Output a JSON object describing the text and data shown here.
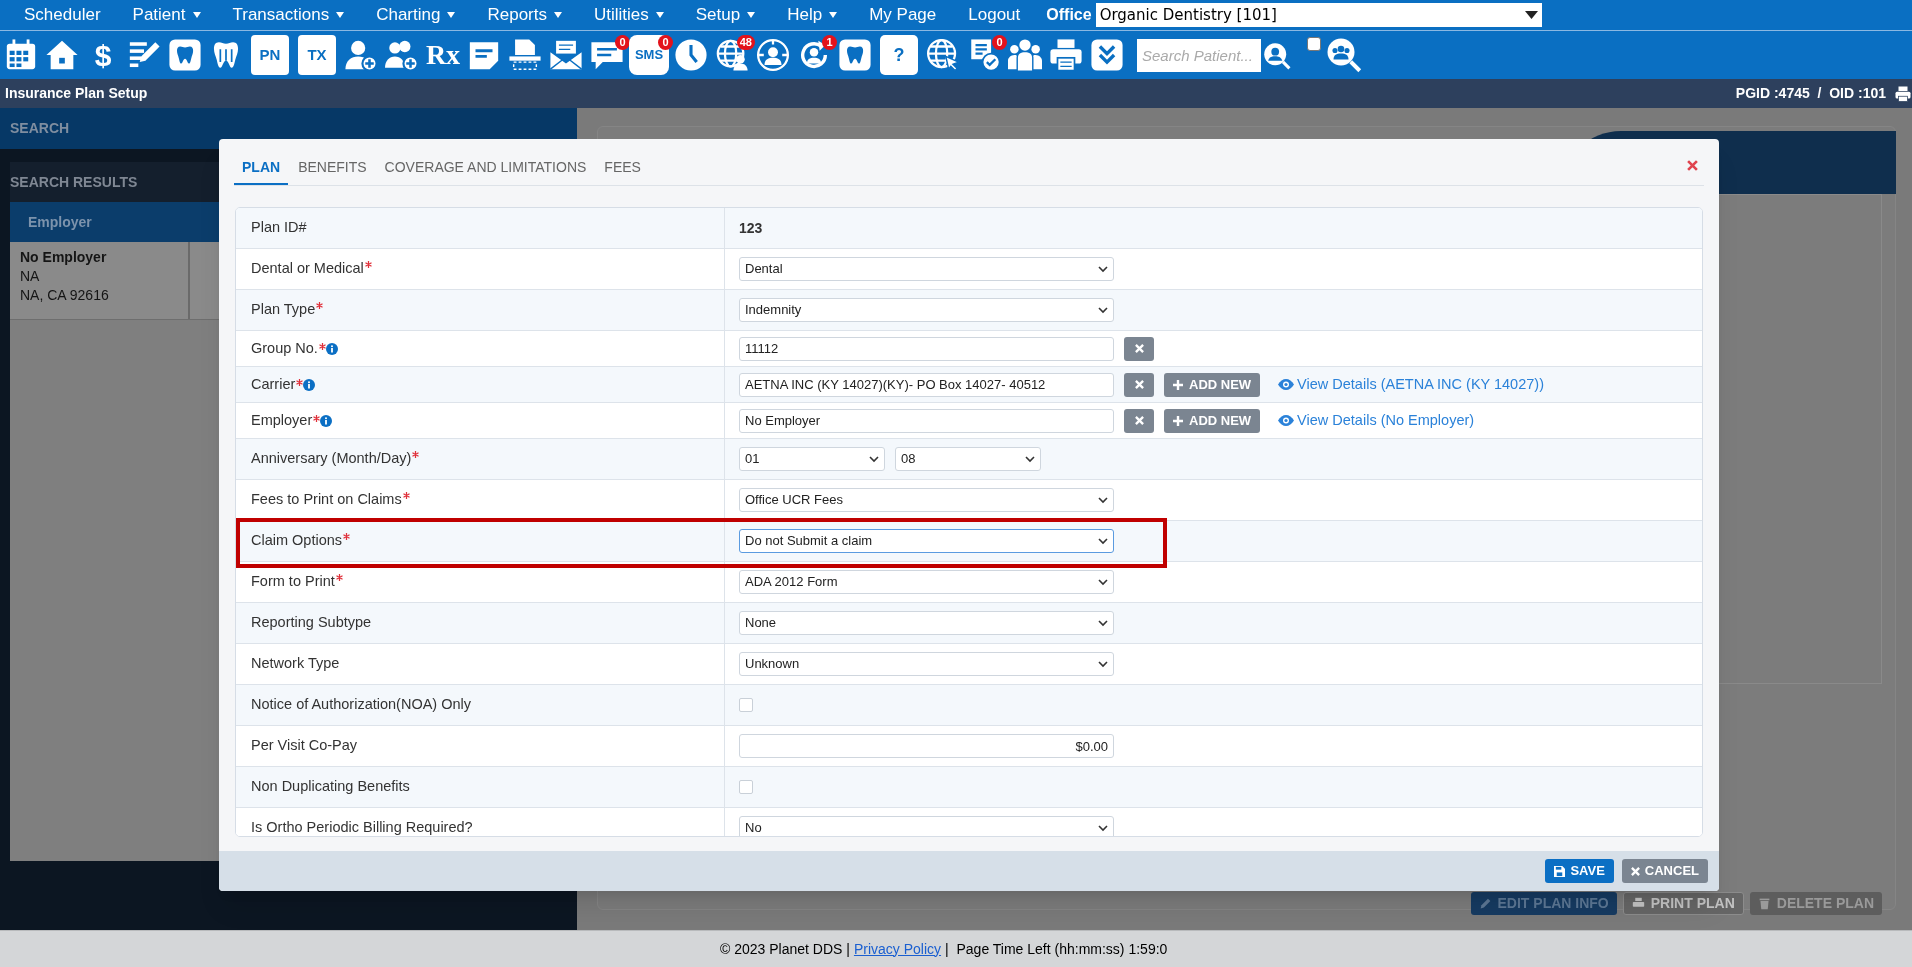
{
  "menu": [
    {
      "label": "Scheduler",
      "dropdown": false
    },
    {
      "label": "Patient",
      "dropdown": true
    },
    {
      "label": "Transactions",
      "dropdown": true
    },
    {
      "label": "Charting",
      "dropdown": true
    },
    {
      "label": "Reports",
      "dropdown": true
    },
    {
      "label": "Utilities",
      "dropdown": true
    },
    {
      "label": "Setup",
      "dropdown": true
    },
    {
      "label": "Help",
      "dropdown": true
    },
    {
      "label": "My Page",
      "dropdown": false
    },
    {
      "label": "Logout",
      "dropdown": false
    }
  ],
  "office": {
    "label": "Office",
    "value": "Organic Dentistry [101]"
  },
  "toolbar": {
    "items": [
      {
        "kind": "calendar"
      },
      {
        "kind": "home"
      },
      {
        "kind": "text",
        "text": "$"
      },
      {
        "kind": "notes"
      },
      {
        "kind": "tooth_card"
      },
      {
        "kind": "tooth"
      },
      {
        "kind": "text",
        "text": "PN"
      },
      {
        "kind": "text",
        "text": "TX"
      },
      {
        "kind": "user_add"
      },
      {
        "kind": "users_add"
      },
      {
        "kind": "rx",
        "text": "Rx"
      },
      {
        "kind": "note"
      },
      {
        "kind": "scanner"
      },
      {
        "kind": "mail"
      },
      {
        "kind": "chat",
        "badge": "0"
      },
      {
        "kind": "bubble",
        "text": "SMS",
        "badge": "0"
      },
      {
        "kind": "clock"
      },
      {
        "kind": "globe_user",
        "badge": "48"
      },
      {
        "kind": "globe_person"
      },
      {
        "kind": "refresh_user",
        "badge": "1"
      },
      {
        "kind": "tooth_card"
      },
      {
        "kind": "tooth_text",
        "text": "?"
      },
      {
        "kind": "globe_cursor"
      },
      {
        "kind": "checklist",
        "badge": "0"
      },
      {
        "kind": "people"
      },
      {
        "kind": "printer"
      },
      {
        "kind": "chevrons"
      }
    ],
    "search": {
      "placeholder": "Search Patient..."
    },
    "checkbox": {
      "checked": false
    }
  },
  "title_bar": {
    "title": "Insurance Plan Setup",
    "ids": "PGID :4745  /  OID :101"
  },
  "search_panel": {
    "header": "SEARCH",
    "results_title": "SEARCH RESULTS",
    "columns": [
      "Employer"
    ],
    "rows": [
      {
        "name": "No Employer",
        "line_2": "NA",
        "line_3": "NA, CA 92616"
      }
    ]
  },
  "background_buttons": [
    {
      "kind": "edit",
      "label": "EDIT PLAN INFO"
    },
    {
      "kind": "print",
      "label": "PRINT PLAN"
    },
    {
      "kind": "delete",
      "label": "DELETE PLAN"
    }
  ],
  "modal": {
    "tabs": [
      {
        "label": "PLAN",
        "selected": true
      },
      {
        "label": "BENEFITS",
        "selected": false
      },
      {
        "label": "COVERAGE AND LIMITATIONS",
        "selected": false
      },
      {
        "label": "FEES",
        "selected": false
      }
    ],
    "fields": [
      {
        "label": "Plan ID#",
        "required": false,
        "info": false,
        "kind": "static",
        "value": "123"
      },
      {
        "label": "Dental or Medical",
        "required": true,
        "info": false,
        "kind": "select",
        "value": "Dental"
      },
      {
        "label": "Plan Type",
        "required": true,
        "info": false,
        "kind": "select",
        "value": "Indemnity"
      },
      {
        "label": "Group No.",
        "required": true,
        "info": true,
        "kind": "input",
        "value": "11112",
        "clear": true
      },
      {
        "label": "Carrier",
        "required": true,
        "info": true,
        "kind": "input",
        "value": "AETNA INC (KY 14027)(KY)- PO Box 14027- 40512",
        "clear": true,
        "add_new": "ADD NEW",
        "link": "View Details (AETNA INC (KY 14027))"
      },
      {
        "label": "Employer",
        "required": true,
        "info": true,
        "kind": "input",
        "value": "No Employer",
        "clear": true,
        "add_new": "ADD NEW",
        "link": "View Details (No Employer)"
      },
      {
        "label": "Anniversary (Month/Day)",
        "required": true,
        "info": false,
        "kind": "pair",
        "values": [
          "01",
          "08"
        ]
      },
      {
        "label": "Fees to Print on Claims",
        "required": true,
        "info": false,
        "kind": "select",
        "value": "Office UCR Fees"
      },
      {
        "label": "Claim Options",
        "required": true,
        "info": false,
        "kind": "select",
        "value": "Do not Submit a claim",
        "focused": true,
        "highlighted": true
      },
      {
        "label": "Form to Print",
        "required": true,
        "info": false,
        "kind": "select",
        "value": "ADA 2012 Form"
      },
      {
        "label": "Reporting Subtype",
        "required": false,
        "info": false,
        "kind": "select",
        "value": "None"
      },
      {
        "label": "Network Type",
        "required": false,
        "info": false,
        "kind": "select",
        "value": "Unknown"
      },
      {
        "label": "Notice of Authorization(NOA) Only",
        "required": false,
        "info": false,
        "kind": "checkbox",
        "checked": false
      },
      {
        "label": "Per Visit Co-Pay",
        "required": false,
        "info": false,
        "kind": "amount",
        "value": "$0.00"
      },
      {
        "label": "Non Duplicating Benefits",
        "required": false,
        "info": false,
        "kind": "checkbox",
        "checked": false
      },
      {
        "label": "Is Ortho Periodic Billing Required?",
        "required": false,
        "info": false,
        "kind": "select",
        "value": "No"
      }
    ],
    "buttons": [
      {
        "kind": "save",
        "label": "SAVE"
      },
      {
        "kind": "cancel",
        "label": "CANCEL"
      }
    ]
  },
  "footer": {
    "copyright": "© 2023 Planet DDS |",
    "link": "Privacy Policy",
    "time_left": "|  Page Time Left (hh:mm:ss) 1:59:0"
  }
}
